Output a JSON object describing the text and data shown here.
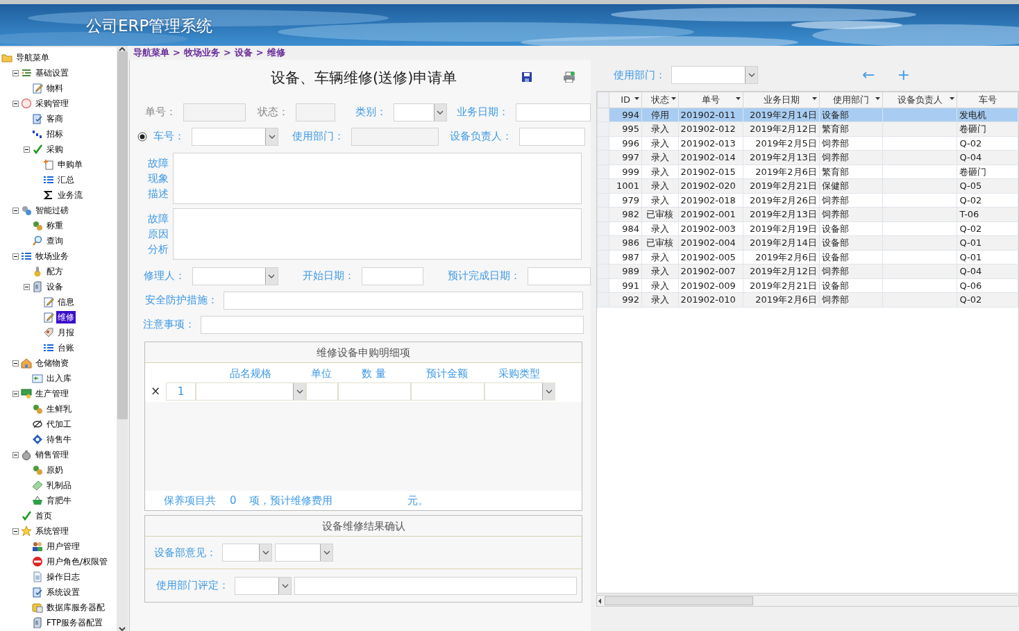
{
  "header": {
    "title": "公司ERP管理系统"
  },
  "sidebar": {
    "items": [
      {
        "label": "导航菜单",
        "selected": false,
        "children": [
          {
            "label": "基础设置",
            "expanded": true,
            "selected": false,
            "children": [
              {
                "label": "物料",
                "selected": false
              }
            ]
          },
          {
            "label": "采购管理",
            "expanded": true,
            "selected": false,
            "children": [
              {
                "label": "客商",
                "selected": false
              },
              {
                "label": "招标",
                "selected": false
              },
              {
                "label": "采购",
                "expanded": true,
                "selected": false,
                "children": [
                  {
                    "label": "申购单",
                    "selected": false
                  },
                  {
                    "label": "汇总",
                    "selected": false
                  },
                  {
                    "label": "业务流",
                    "selected": false
                  }
                ]
              }
            ]
          },
          {
            "label": "智能过磅",
            "expanded": true,
            "selected": false,
            "children": [
              {
                "label": "称重",
                "selected": false
              },
              {
                "label": "查询",
                "selected": false
              }
            ]
          },
          {
            "label": "牧场业务",
            "expanded": true,
            "selected": false,
            "children": [
              {
                "label": "配方",
                "selected": false
              },
              {
                "label": "设备",
                "expanded": true,
                "selected": false,
                "children": [
                  {
                    "label": "信息",
                    "selected": false
                  },
                  {
                    "label": "维修",
                    "selected": true
                  },
                  {
                    "label": "月报",
                    "selected": false
                  },
                  {
                    "label": "台账",
                    "selected": false
                  }
                ]
              }
            ]
          },
          {
            "label": "仓储物资",
            "expanded": true,
            "selected": false,
            "children": [
              {
                "label": "出入库",
                "selected": false
              }
            ]
          },
          {
            "label": "生产管理",
            "expanded": true,
            "selected": false,
            "children": [
              {
                "label": "生鲜乳",
                "selected": false
              },
              {
                "label": "代加工",
                "selected": false
              },
              {
                "label": "待售牛",
                "selected": false
              }
            ]
          },
          {
            "label": "销售管理",
            "expanded": true,
            "selected": false,
            "children": [
              {
                "label": "原奶",
                "selected": false
              },
              {
                "label": "乳制品",
                "selected": false
              },
              {
                "label": "育肥牛",
                "selected": false
              }
            ]
          },
          {
            "label": "首页",
            "selected": false
          },
          {
            "label": "系统管理",
            "expanded": true,
            "selected": false,
            "children": [
              {
                "label": "用户管理",
                "selected": false
              },
              {
                "label": "用户角色/权限管",
                "selected": false
              },
              {
                "label": "操作日志",
                "selected": false
              },
              {
                "label": "系统设置",
                "selected": false
              },
              {
                "label": "数据库服务器配",
                "selected": false
              },
              {
                "label": "FTP服务器配置",
                "selected": false
              }
            ]
          }
        ]
      }
    ]
  },
  "breadcrumb": [
    "导航菜单",
    "牧场业务",
    "设备",
    "维修"
  ],
  "breadcrumb_separator": ">",
  "form": {
    "title": "设备、车辆维修(送修)申请单",
    "row1": [
      {
        "label": "单号：",
        "kind": "readonly",
        "muted": true
      },
      {
        "label": "状态：",
        "kind": "readonly",
        "muted": true
      },
      {
        "label": "类别：",
        "kind": "select",
        "muted": false
      },
      {
        "label": "业务日期：",
        "kind": "text",
        "muted": false
      }
    ],
    "vehicle_radio": {
      "checked": true
    },
    "row2": [
      {
        "label": "车号：",
        "kind": "select",
        "muted": false
      },
      {
        "label": "使用部门：",
        "kind": "readonly",
        "muted": false
      },
      {
        "label": "设备负责人：",
        "kind": "text",
        "muted": false
      }
    ],
    "memos": [
      {
        "label": "故障现象描述"
      },
      {
        "label": "故障原因分析"
      }
    ],
    "row3": [
      {
        "label": "修理人：",
        "kind": "select",
        "muted": false
      },
      {
        "label": "开始日期：",
        "kind": "text",
        "muted": false
      },
      {
        "label": "预计完成日期：",
        "kind": "text",
        "muted": false
      }
    ],
    "safety": {
      "label": "安全防护措施："
    },
    "notes": {
      "label": "注意事项："
    },
    "detail": {
      "title": "维修设备申购明细项",
      "columns": [
        {
          "label": "品名规格",
          "kind": "select"
        },
        {
          "label": "单位",
          "kind": "text"
        },
        {
          "label": "数 量",
          "kind": "text"
        },
        {
          "label": "预计金额",
          "kind": "text"
        },
        {
          "label": "采购类型",
          "kind": "select"
        }
      ],
      "rows": [
        {
          "delete": "×",
          "index": "1"
        }
      ],
      "summary": {
        "prefix": "保养项目共",
        "count": "0",
        "middle": "项，预计维修费用",
        "suffix": "元。"
      }
    },
    "result": {
      "title": "设备维修结果确认",
      "rows": [
        {
          "label": "设备部意见：",
          "controls": [
            {
              "kind": "select"
            },
            {
              "kind": "select"
            }
          ]
        },
        {
          "label": "使用部门评定：",
          "controls": [
            {
              "kind": "select"
            },
            {
              "kind": "wide"
            }
          ]
        }
      ]
    }
  },
  "filter": {
    "label": "使用部门：",
    "back": "←",
    "add": "+"
  },
  "table": {
    "columns": [
      {
        "label": "ID",
        "menu": true
      },
      {
        "label": "状态",
        "menu": true
      },
      {
        "label": "单号",
        "menu": true
      },
      {
        "label": "业务日期",
        "menu": true
      },
      {
        "label": "使用部门",
        "menu": true
      },
      {
        "label": "设备负责人",
        "menu": true
      },
      {
        "label": "车号",
        "menu": false
      }
    ],
    "rows": [
      {
        "id": "994",
        "status": "停用",
        "number": "201902-011",
        "date": "2019年2月14日",
        "dept": "设备部",
        "vehicle": "发电机",
        "selected": true
      },
      {
        "id": "995",
        "status": "录入",
        "number": "201902-012",
        "date": "2019年2月12日",
        "dept": "繁育部",
        "vehicle": "卷砸门",
        "selected": false
      },
      {
        "id": "996",
        "status": "录入",
        "number": "201902-013",
        "date": "2019年2月5日",
        "dept": "饲养部",
        "vehicle": "Q-02",
        "selected": false
      },
      {
        "id": "997",
        "status": "录入",
        "number": "201902-014",
        "date": "2019年2月13日",
        "dept": "饲养部",
        "vehicle": "Q-04",
        "selected": false
      },
      {
        "id": "999",
        "status": "录入",
        "number": "201902-015",
        "date": "2019年2月6日",
        "dept": "繁育部",
        "vehicle": "卷砸门",
        "selected": false
      },
      {
        "id": "1001",
        "status": "录入",
        "number": "201902-020",
        "date": "2019年2月21日",
        "dept": "保健部",
        "vehicle": "Q-05",
        "selected": false
      },
      {
        "id": "979",
        "status": "录入",
        "number": "201902-018",
        "date": "2019年2月26日",
        "dept": "饲养部",
        "vehicle": "Q-02",
        "selected": false
      },
      {
        "id": "982",
        "status": "已审核",
        "number": "201902-001",
        "date": "2019年2月13日",
        "dept": "饲养部",
        "vehicle": "T-06",
        "selected": false
      },
      {
        "id": "984",
        "status": "录入",
        "number": "201902-003",
        "date": "2019年2月19日",
        "dept": "设备部",
        "vehicle": "Q-02",
        "selected": false
      },
      {
        "id": "986",
        "status": "已审核",
        "number": "201902-004",
        "date": "2019年2月14日",
        "dept": "设备部",
        "vehicle": "Q-01",
        "selected": false
      },
      {
        "id": "987",
        "status": "录入",
        "number": "201902-005",
        "date": "2019年2月6日",
        "dept": "设备部",
        "vehicle": "Q-01",
        "selected": false
      },
      {
        "id": "989",
        "status": "录入",
        "number": "201902-007",
        "date": "2019年2月12日",
        "dept": "饲养部",
        "vehicle": "Q-04",
        "selected": false
      },
      {
        "id": "991",
        "status": "录入",
        "number": "201902-009",
        "date": "2019年2月21日",
        "dept": "设备部",
        "vehicle": "Q-06",
        "selected": false
      },
      {
        "id": "992",
        "status": "录入",
        "number": "201902-010",
        "date": "2019年2月6日",
        "dept": "饲养部",
        "vehicle": "Q-02",
        "selected": false
      }
    ]
  }
}
